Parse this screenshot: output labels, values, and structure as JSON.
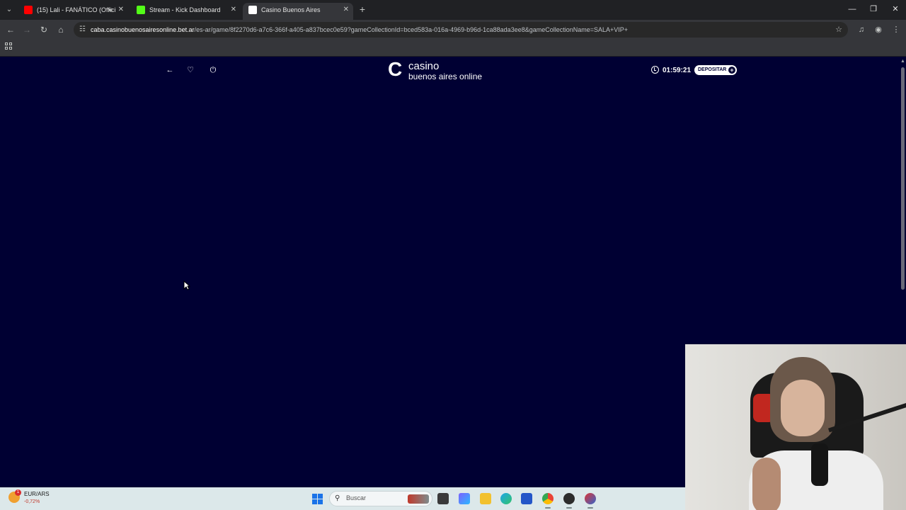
{
  "browser": {
    "tabs": [
      {
        "label": "(15) Lali - FANÁTICO (Offici",
        "favicon_color": "#ff0000",
        "audio": true
      },
      {
        "label": "Stream - Kick Dashboard",
        "favicon_color": "#53fc18"
      },
      {
        "label": "Casino Buenos Aires",
        "favicon_color": "#ffffff",
        "active": true
      }
    ],
    "url_host": "caba.casinobuenosairesonline.bet.ar",
    "url_path": "/es-ar/game/8f2270d6-a7c6-366f-a405-a837bcec0e59?gameCollectionId=bced583a-016a-4969-b96d-1ca88ada3ee8&gameCollectionName=SALA+VIP+"
  },
  "site": {
    "logo_line1": "casino",
    "logo_line2": "buenos aires online",
    "logo_mark": "C",
    "timer": "01:59:21",
    "deposit_label": "DEPOSITAR",
    "deposit_icon": "+",
    "background_color": "#000033"
  },
  "taskbar": {
    "weather_badge": "1",
    "ticker_pair": "EUR/ARS",
    "ticker_change": "-0,72%",
    "search_placeholder": "Buscar",
    "apps": [
      "file-explorer-icon",
      "teams-icon",
      "folder-icon",
      "edge-icon",
      "store-icon",
      "chrome-icon",
      "obs-icon",
      "casino-app-icon"
    ]
  }
}
